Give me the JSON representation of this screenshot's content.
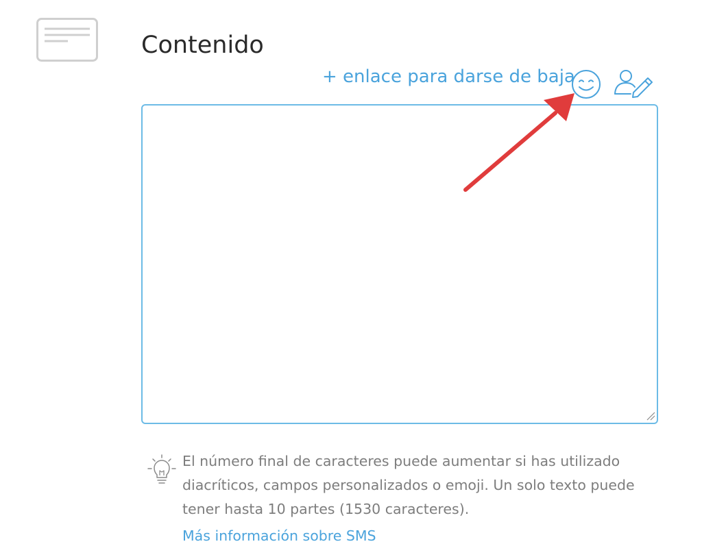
{
  "section": {
    "title": "Contenido",
    "icon": "document-lines-icon"
  },
  "toolbar": {
    "unsubscribe_link": "+ enlace para darse de baja",
    "emoji_icon": "smiley-face-icon",
    "personalize_icon": "user-pencil-icon"
  },
  "editor": {
    "value": "",
    "placeholder": ""
  },
  "hint": {
    "icon": "lightbulb-icon",
    "text": "El número final de caracteres puede aumentar si has utilizado diacríticos, campos personalizados o emoji. Un solo texto puede tener hasta 10 partes (1530 caracteres).",
    "more_info_link": "Más información sobre SMS"
  },
  "colors": {
    "accent": "#4aa3dc",
    "border": "#6cbbe6",
    "annotation_arrow": "#e03c3c",
    "muted_text": "#7d7d7d",
    "title_text": "#2a2a2a"
  }
}
